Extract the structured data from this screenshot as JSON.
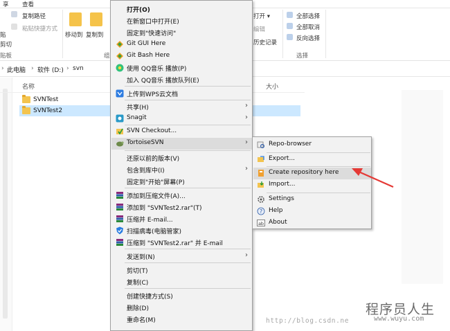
{
  "ribbon": {
    "tabs": [
      "享",
      "查看"
    ],
    "copy_path": "复制路径",
    "paste_shortcut": "粘贴快捷方式",
    "paste_short": "贴",
    "cut": "剪切",
    "move_to": "移动到",
    "copy_to": "复制到",
    "group_clipboard": "贴板",
    "group_organize": "组",
    "open": "打开 ▾",
    "edit": "编辑",
    "history": "历史记录",
    "select_all": "全部选择",
    "select_none": "全部取消",
    "invert_select": "反向选择",
    "group_select": "选择"
  },
  "address": {
    "crumbs": [
      "此电脑",
      "软件 (D:)",
      "svn"
    ],
    "separator": "›"
  },
  "columns": {
    "name": "名称",
    "size": "大小"
  },
  "files": [
    {
      "name": "SVNTest"
    },
    {
      "name": "SVNTest2"
    }
  ],
  "context_menu": {
    "open": "打开(O)",
    "open_new_window": "在新窗口中打开(E)",
    "pin_quick": "固定到\"快速访问\"",
    "git_gui": "Git GUI Here",
    "git_bash": "Git Bash Here",
    "qq_play": "使用 QQ音乐 播放(P)",
    "qq_queue": "加入 QQ音乐 播放队列(E)",
    "wps": "上传到WPS云文档",
    "share": "共享(H)",
    "snagit": "Snagit",
    "svn_checkout": "SVN Checkout...",
    "tortoise": "TortoiseSVN",
    "restore": "还原以前的版本(V)",
    "include_lib": "包含到库中(I)",
    "pin_start": "固定到\"开始\"屏幕(P)",
    "add_archive": "添加到压缩文件(A)...",
    "add_rar": "添加到 \"SVNTest2.rar\"(T)",
    "compress_email": "压缩并 E-mail...",
    "scan_virus": "扫描病毒(电脑管家)",
    "compress_rar_email": "压缩到 \"SVNTest2.rar\" 并 E-mail",
    "send_to": "发送到(N)",
    "cut": "剪切(T)",
    "copy": "复制(C)",
    "create_shortcut": "创建快捷方式(S)",
    "delete": "删除(D)",
    "rename": "重命名(M)",
    "arrow": "›"
  },
  "submenu": {
    "repo_browser": "Repo-browser",
    "export": "Export...",
    "create_repo": "Create repository here",
    "import": "Import...",
    "settings": "Settings",
    "help": "Help",
    "about": "About"
  },
  "watermark": {
    "site_cn": "程序员人生",
    "site_url": "www.wuyu.com",
    "blog": "http://blog.csdn.ne"
  },
  "colors": {
    "annotation_arrow": "#e53935",
    "selection": "#cce8ff",
    "menu_bg": "#f2f2f2"
  }
}
